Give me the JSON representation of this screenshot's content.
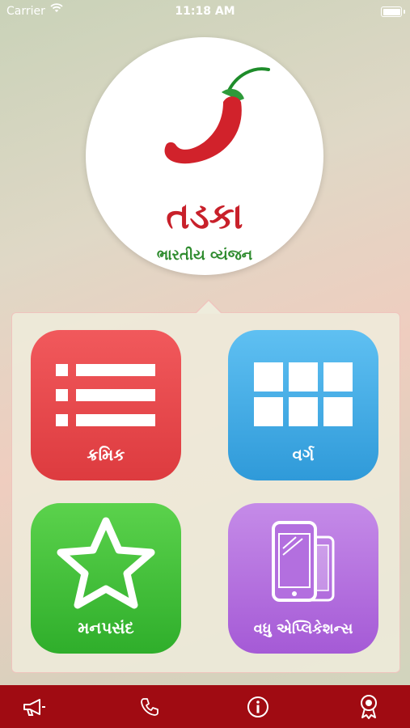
{
  "status_bar": {
    "carrier": "Carrier",
    "time": "11:18 AM",
    "wifi_icon": "wifi-icon",
    "battery_icon": "battery-icon"
  },
  "logo": {
    "title": "તડકા",
    "subtitle": "ભારતીય વ્યંજન",
    "chili_icon": "chili-icon"
  },
  "menu": {
    "tiles": [
      {
        "label": "ક્રમિક",
        "icon": "list-icon",
        "color": "#e94a4d"
      },
      {
        "label": "વર્ગ",
        "icon": "grid-icon",
        "color": "#45abe6"
      },
      {
        "label": "મનપસંદ",
        "icon": "star-icon",
        "color": "#3fc13b"
      },
      {
        "label": "વધુ એપ્લિકેશન્સ",
        "icon": "devices-icon",
        "color": "#b36fdf"
      }
    ]
  },
  "tab_bar": {
    "color": "#a00b12",
    "tabs": [
      {
        "icon": "megaphone-icon"
      },
      {
        "icon": "phone-icon"
      },
      {
        "icon": "info-icon"
      },
      {
        "icon": "award-icon"
      }
    ]
  }
}
